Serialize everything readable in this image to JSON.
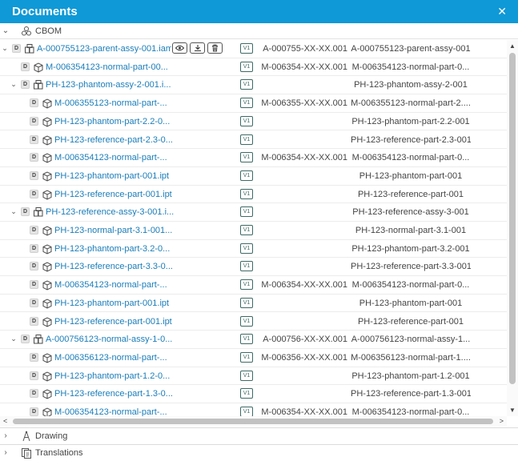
{
  "header": {
    "title": "Documents",
    "close_glyph": "✕"
  },
  "sections": {
    "cbom": {
      "label": "CBOM",
      "icon": "cbom-icon"
    },
    "drawing": {
      "label": "Drawing",
      "icon": "drawing-compass-icon"
    },
    "translations": {
      "label": "Translations",
      "icon": "translations-icon"
    }
  },
  "glyphs": {
    "expanded": "⌄",
    "collapsed": "›",
    "badge": "D",
    "scroll_up": "▲",
    "scroll_down": "▼",
    "scroll_left": "<",
    "scroll_right": ">"
  },
  "tree_rows": [
    {
      "level": 0,
      "type": "assy",
      "expanded": true,
      "name": "A-000755123-parent-assy-001.iam",
      "version": "V1",
      "part_number": "A-000755-XX-XX.001",
      "description": "A-000755123-parent-assy-001",
      "actions": true
    },
    {
      "level": 1,
      "type": "part",
      "name": "M-006354123-normal-part-00...",
      "version": "V1",
      "part_number": "M-006354-XX-XX.001",
      "description": "M-006354123-normal-part-0..."
    },
    {
      "level": 1,
      "type": "assy",
      "expanded": true,
      "name": "PH-123-phantom-assy-2-001.i...",
      "version": "V1",
      "part_number": "",
      "description": "PH-123-phantom-assy-2-001"
    },
    {
      "level": 2,
      "type": "part",
      "name": "M-006355123-normal-part-...",
      "version": "V1",
      "part_number": "M-006355-XX-XX.001",
      "description": "M-006355123-normal-part-2...."
    },
    {
      "level": 2,
      "type": "part",
      "name": "PH-123-phantom-part-2.2-0...",
      "version": "V1",
      "part_number": "",
      "description": "PH-123-phantom-part-2.2-001"
    },
    {
      "level": 2,
      "type": "part",
      "name": "PH-123-reference-part-2.3-0...",
      "version": "V1",
      "part_number": "",
      "description": "PH-123-reference-part-2.3-001"
    },
    {
      "level": 2,
      "type": "part",
      "name": "M-006354123-normal-part-...",
      "version": "V1",
      "part_number": "M-006354-XX-XX.001",
      "description": "M-006354123-normal-part-0..."
    },
    {
      "level": 2,
      "type": "part",
      "name": "PH-123-phantom-part-001.ipt",
      "version": "V1",
      "part_number": "",
      "description": "PH-123-phantom-part-001"
    },
    {
      "level": 2,
      "type": "part",
      "name": "PH-123-reference-part-001.ipt",
      "version": "V1",
      "part_number": "",
      "description": "PH-123-reference-part-001"
    },
    {
      "level": 1,
      "type": "assy",
      "expanded": true,
      "name": "PH-123-reference-assy-3-001.i...",
      "version": "V1",
      "part_number": "",
      "description": "PH-123-reference-assy-3-001"
    },
    {
      "level": 2,
      "type": "part",
      "name": "PH-123-normal-part-3.1-001...",
      "version": "V1",
      "part_number": "",
      "description": "PH-123-normal-part-3.1-001"
    },
    {
      "level": 2,
      "type": "part",
      "name": "PH-123-phantom-part-3.2-0...",
      "version": "V1",
      "part_number": "",
      "description": "PH-123-phantom-part-3.2-001"
    },
    {
      "level": 2,
      "type": "part",
      "name": "PH-123-reference-part-3.3-0...",
      "version": "V1",
      "part_number": "",
      "description": "PH-123-reference-part-3.3-001"
    },
    {
      "level": 2,
      "type": "part",
      "name": "M-006354123-normal-part-...",
      "version": "V1",
      "part_number": "M-006354-XX-XX.001",
      "description": "M-006354123-normal-part-0..."
    },
    {
      "level": 2,
      "type": "part",
      "name": "PH-123-phantom-part-001.ipt",
      "version": "V1",
      "part_number": "",
      "description": "PH-123-phantom-part-001"
    },
    {
      "level": 2,
      "type": "part",
      "name": "PH-123-reference-part-001.ipt",
      "version": "V1",
      "part_number": "",
      "description": "PH-123-reference-part-001"
    },
    {
      "level": 1,
      "type": "assy",
      "expanded": true,
      "name": "A-000756123-normal-assy-1-0...",
      "version": "V1",
      "part_number": "A-000756-XX-XX.001",
      "description": "A-000756123-normal-assy-1..."
    },
    {
      "level": 2,
      "type": "part",
      "name": "M-006356123-normal-part-...",
      "version": "V1",
      "part_number": "M-006356-XX-XX.001",
      "description": "M-006356123-normal-part-1...."
    },
    {
      "level": 2,
      "type": "part",
      "name": "PH-123-phantom-part-1.2-0...",
      "version": "V1",
      "part_number": "",
      "description": "PH-123-phantom-part-1.2-001"
    },
    {
      "level": 2,
      "type": "part",
      "name": "PH-123-reference-part-1.3-0...",
      "version": "V1",
      "part_number": "",
      "description": "PH-123-reference-part-1.3-001"
    },
    {
      "level": 2,
      "type": "part",
      "name": "M-006354123-normal-part-...",
      "version": "V1",
      "part_number": "M-006354-XX-XX.001",
      "description": "M-006354123-normal-part-0..."
    }
  ],
  "row_actions": [
    "view-eye-icon",
    "download-icon",
    "delete-trash-icon"
  ],
  "colors": {
    "accent": "#0f99d6",
    "link": "#1a7db9",
    "version_badge": "#3d6a63"
  }
}
